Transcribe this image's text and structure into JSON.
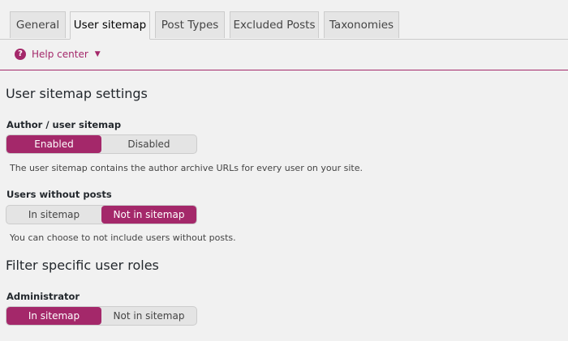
{
  "tabs": [
    "General",
    "User sitemap",
    "Post Types",
    "Excluded Posts",
    "Taxonomies"
  ],
  "active_tab": "User sitemap",
  "help": {
    "label": "Help center",
    "icon": "question-circle-icon"
  },
  "section_title": "User sitemap settings",
  "author_sitemap": {
    "label": "Author / user sitemap",
    "options": [
      "Enabled",
      "Disabled"
    ],
    "selected": "Enabled",
    "description": "The user sitemap contains the author archive URLs for every user on your site."
  },
  "users_without_posts": {
    "label": "Users without posts",
    "options": [
      "In sitemap",
      "Not in sitemap"
    ],
    "selected": "Not in sitemap",
    "description": "You can choose to not include users without posts."
  },
  "roles_title": "Filter specific user roles",
  "administrator": {
    "label": "Administrator",
    "options": [
      "In sitemap",
      "Not in sitemap"
    ],
    "selected": "In sitemap"
  },
  "colors": {
    "accent": "#a4286a",
    "background": "#f1f1f1"
  }
}
